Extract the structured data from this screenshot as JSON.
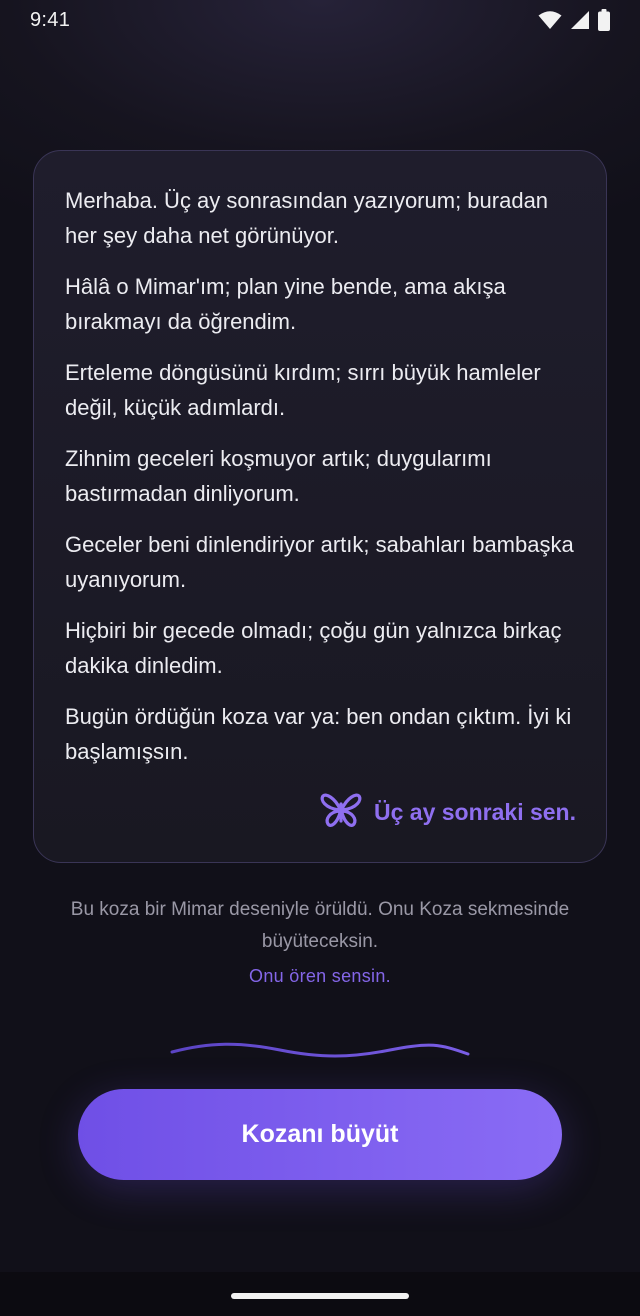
{
  "status_bar": {
    "time": "9:41",
    "icons": [
      "wifi-icon",
      "cell-signal-icon",
      "battery-icon"
    ]
  },
  "letter": {
    "paragraphs": [
      "Merhaba. Üç ay sonrasından yazıyorum; buradan her şey daha net görünüyor.",
      "Hâlâ o Mimar'ım; plan yine bende, ama akışa bırakmayı da öğrendim.",
      "Erteleme döngüsünü kırdım; sırrı büyük hamleler değil, küçük adımlardı.",
      "Zihnim geceleri koşmuyor artık; duygularımı bastırmadan dinliyorum.",
      "Geceler beni dinlendiriyor artık; sabahları bambaşka uyanıyorum.",
      "Hiçbiri bir gecede olmadı; çoğu gün yalnızca birkaç dakika dinledim.",
      "Bugün ördüğün koza var ya: ben ondan çıktım. İyi ki başlamışsın."
    ],
    "signature": "Üç ay sonraki sen.",
    "signature_icon": "butterfly-icon"
  },
  "caption": "Bu koza bir Mimar deseniyle örüldü. Onu Koza sekmesinde büyüteceksin.",
  "tagline": "Onu ören sensin.",
  "cta": {
    "label": "Kozanı büyüt"
  },
  "colors": {
    "accent": "#8f6ff0",
    "button_start": "#6f4fe6",
    "button_end": "#8a6cf5",
    "background": "#16141f",
    "card_border": "#3a3556"
  }
}
